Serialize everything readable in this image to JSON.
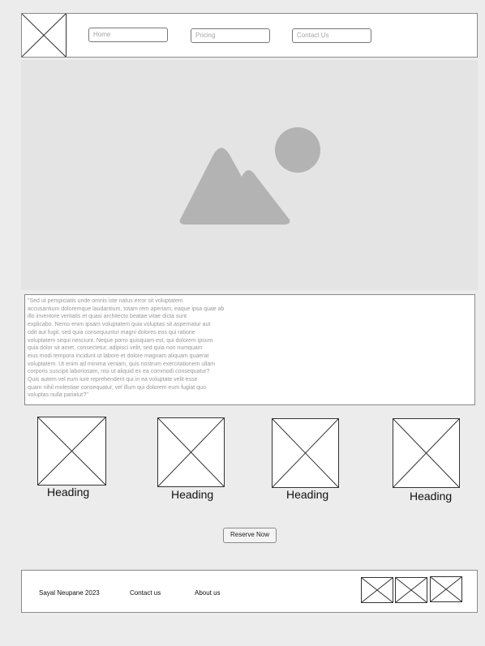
{
  "header": {
    "logo_icon": "placeholder-image-icon",
    "nav": [
      {
        "label": "Home"
      },
      {
        "label": "Pricing"
      },
      {
        "label": "Contact Us"
      }
    ]
  },
  "hero": {
    "image_icon": "mountain-sun-image-icon",
    "colors": {
      "background": "#e4e4e4",
      "shape": "#b3b3b3"
    }
  },
  "main": {
    "paragraph": "\"Sed ut perspiciatis unde omnis iste natus error sit voluptatem\naccusantium doloremque laudantium, totam rem aperiam, eaque ipsa quae ab\n illo inventore veritatis et quasi architecto beatae vitae dicta sunt\nexplicabo. Nemo enim ipsam voluptatem quia voluptas sit aspernatur aut\nodit aut fugit, sed quia consequuntur magni dolores eos qui ratione\nvoluptatem sequi nesciunt. Neque porro quisquam est, qui dolorem ipsum\nquia dolor sit amet, consectetur, adipisci velit, sed quia non numquam\neius modi tempora incidunt ut labore et dolore magnam aliquam quaerat\nvoluptatem. Ut enim ad minima veniam, quis nostrum exercitationem ullam\ncorporis suscipit laboriosam, nisi ut aliquid ex ea commodi consequatur?\n Quis autem vel eum iure reprehenderit qui in ea voluptate velit esse\nquam nihil molestiae consequatur, vel illum qui dolorem eum fugiat quo\nvoluptas nulla pariatur?\""
  },
  "cards": [
    {
      "heading": "Heading",
      "icon": "placeholder-image-icon"
    },
    {
      "heading": "Heading",
      "icon": "placeholder-image-icon"
    },
    {
      "heading": "Heading",
      "icon": "placeholder-image-icon"
    },
    {
      "heading": "Heading",
      "icon": "placeholder-image-icon"
    }
  ],
  "cta": {
    "label": "Reserve Now"
  },
  "footer": {
    "copyright": "Sayal Neupane 2023",
    "links": [
      {
        "label": "Contact us"
      },
      {
        "label": "About us"
      }
    ],
    "social_icons": [
      "placeholder-image-icon",
      "placeholder-image-icon",
      "placeholder-image-icon"
    ]
  }
}
